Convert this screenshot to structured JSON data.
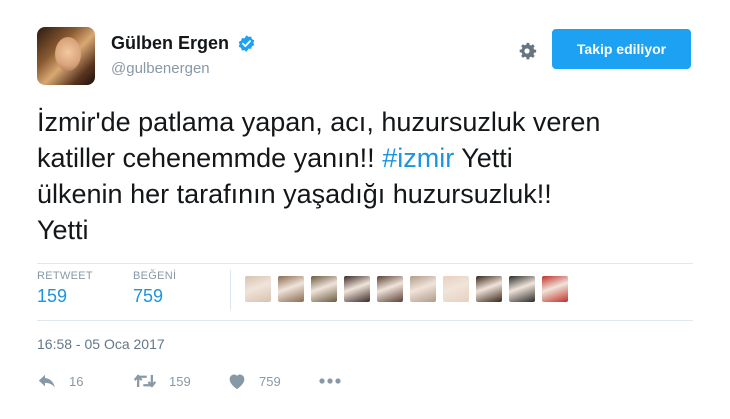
{
  "profile": {
    "name": "Gülben Ergen",
    "handle": "@gulbenergen"
  },
  "follow_button": {
    "label": "Takip ediliyor"
  },
  "tweet": {
    "line1": "İzmir'de patlama yapan, acı, huzursuzluk veren",
    "line2_before": "katiller cehenemmde yanın!! ",
    "hashtag": "#izmir",
    "line2_after": " Yetti",
    "line3": "ülkenin her tarafının yaşadığı huzursuzluk!!",
    "line4": "Yetti"
  },
  "stats": {
    "retweets_label": "RETWEET",
    "retweets": "159",
    "likes_label": "BEĞENİ",
    "likes": "759"
  },
  "liker_colors": [
    "#d8c2b0",
    "#8a6a50",
    "#6a5a40",
    "#3a2a26",
    "#5a4034",
    "#b09a88",
    "#e7d0c0",
    "#3a2418",
    "#2a2a2a",
    "#c0302a"
  ],
  "timestamp": "16:58 - 05 Oca 2017",
  "actions": {
    "reply_count": "16",
    "retweet_count": "159",
    "like_count": "759"
  },
  "icons": {
    "verified": "verified-badge-icon",
    "gear": "gear-icon",
    "reply": "reply-icon",
    "retweet": "retweet-icon",
    "like": "heart-icon",
    "more": "more-icon"
  },
  "colors": {
    "accent": "#1da1f2",
    "link": "#1b95e0",
    "muted": "#8899a6"
  }
}
